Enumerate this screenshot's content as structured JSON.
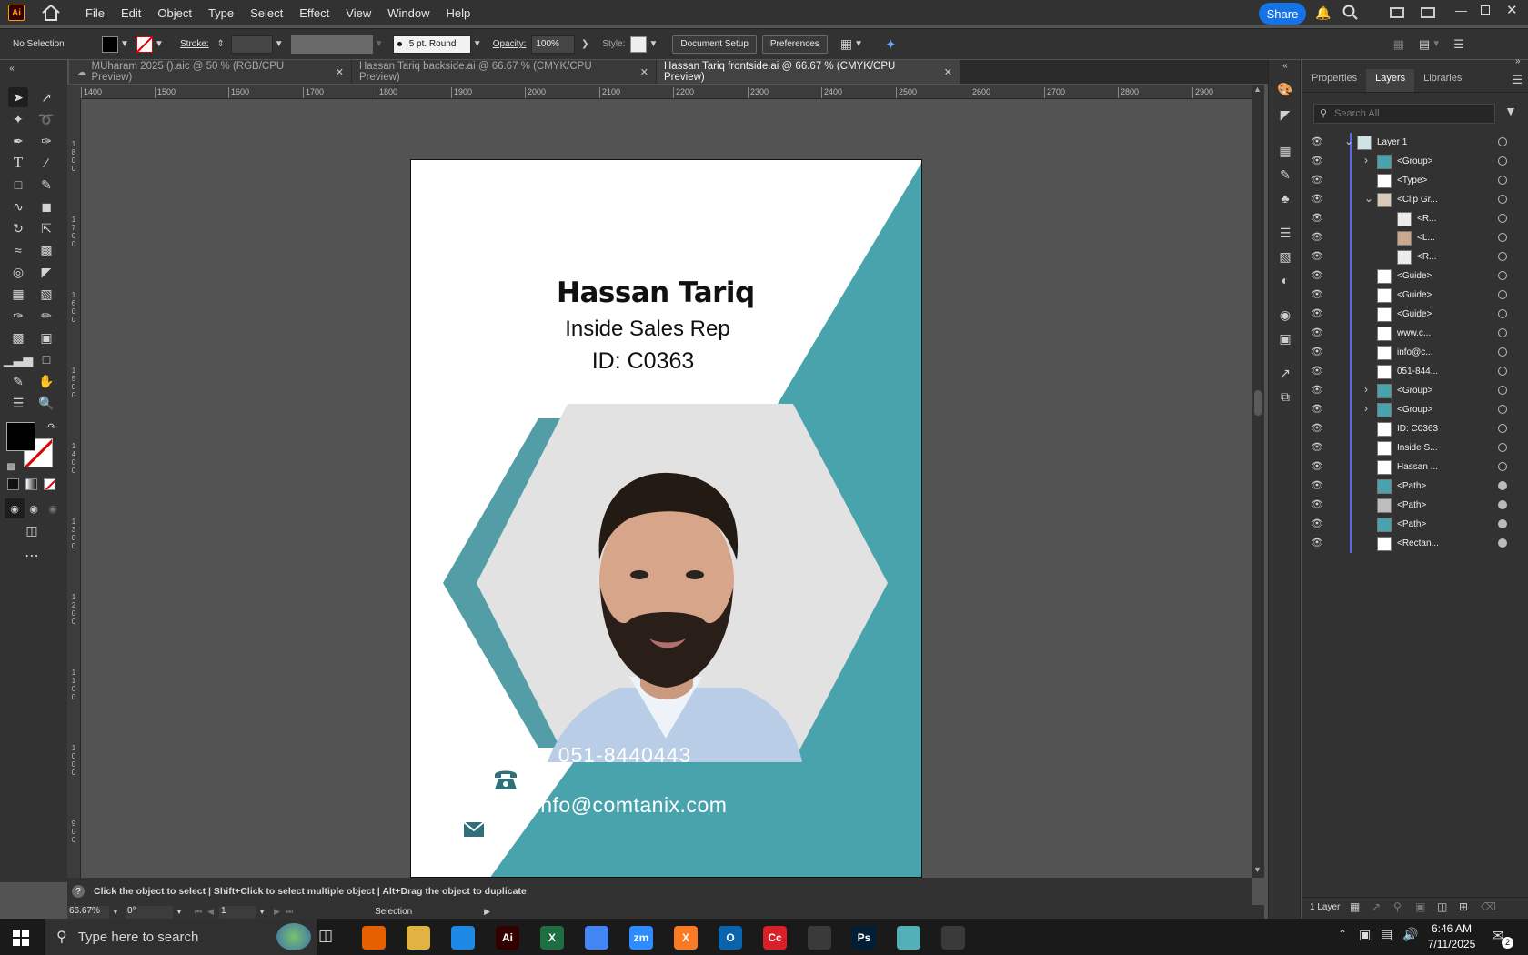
{
  "app": {
    "logo_text": "Ai"
  },
  "menu": [
    "File",
    "Edit",
    "Object",
    "Type",
    "Select",
    "Effect",
    "View",
    "Window",
    "Help"
  ],
  "share_label": "Share",
  "control": {
    "selection": "No Selection",
    "stroke_label": "Stroke:",
    "brush": "5 pt. Round",
    "opacity_label": "Opacity:",
    "opacity_value": "100%",
    "style_label": "Style:",
    "document_setup": "Document Setup",
    "preferences": "Preferences"
  },
  "tabs": [
    {
      "label": "MUharam 2025 ().aic @ 50 % (RGB/CPU Preview)",
      "active": false
    },
    {
      "label": "Hassan Tariq backside.ai @ 66.67 % (CMYK/CPU Preview)",
      "active": false
    },
    {
      "label": "Hassan Tariq frontside.ai @ 66.67 % (CMYK/CPU Preview)",
      "active": true
    }
  ],
  "ruler_h": [
    "1400",
    "1500",
    "1600",
    "1700",
    "1800",
    "1900",
    "2000",
    "2100",
    "2200",
    "2300",
    "2400",
    "2500",
    "2600",
    "2700",
    "2800",
    "2900"
  ],
  "ruler_v": [
    "1800",
    "1700",
    "1600",
    "1500",
    "1400",
    "1300",
    "1200",
    "1100",
    "1000",
    "900"
  ],
  "card": {
    "name": "Hassan Tariq",
    "title": "Inside Sales Rep",
    "id": "ID:  C0363",
    "phone": "051-8440443",
    "email": "info@comtanix.com",
    "accent": "#48a3ac",
    "hex_fill": "#e2e2e2"
  },
  "status": {
    "help": "?",
    "text": "Click the object to select  |  Shift+Click to select multiple object  |  Alt+Drag the object to duplicate",
    "zoom": "66.67%",
    "rotation": "0°",
    "artboard": "1",
    "tool": "Selection"
  },
  "panel": {
    "tabs": [
      "Properties",
      "Layers",
      "Libraries"
    ],
    "search_placeholder": "Search All",
    "layers": [
      {
        "label": "Layer 1",
        "indent": 0,
        "expand": "v",
        "circle": false,
        "thumb": "#cfe3e6"
      },
      {
        "label": "<Group>",
        "indent": 1,
        "expand": ">",
        "circle": false,
        "thumb": "#48a3ac"
      },
      {
        "label": "<Type>",
        "indent": 1,
        "expand": "",
        "circle": false,
        "thumb": "#ffffff"
      },
      {
        "label": "<Clip Gr...",
        "indent": 1,
        "expand": "v",
        "circle": false,
        "thumb": "#d9c9b8"
      },
      {
        "label": "<R...",
        "indent": 2,
        "expand": "",
        "circle": false,
        "thumb": "#ececec"
      },
      {
        "label": "<L...",
        "indent": 2,
        "expand": "",
        "circle": false,
        "thumb": "#caa88c"
      },
      {
        "label": "<R...",
        "indent": 2,
        "expand": "",
        "circle": false,
        "thumb": "#ececec"
      },
      {
        "label": "<Guide>",
        "indent": 1,
        "expand": "",
        "circle": false,
        "thumb": "#ffffff"
      },
      {
        "label": "<Guide>",
        "indent": 1,
        "expand": "",
        "circle": false,
        "thumb": "#ffffff"
      },
      {
        "label": "<Guide>",
        "indent": 1,
        "expand": "",
        "circle": false,
        "thumb": "#ffffff"
      },
      {
        "label": "www.c...",
        "indent": 1,
        "expand": "",
        "circle": false,
        "thumb": "#ffffff"
      },
      {
        "label": "info@c...",
        "indent": 1,
        "expand": "",
        "circle": false,
        "thumb": "#ffffff"
      },
      {
        "label": "051-844...",
        "indent": 1,
        "expand": "",
        "circle": false,
        "thumb": "#ffffff"
      },
      {
        "label": "<Group>",
        "indent": 1,
        "expand": ">",
        "circle": false,
        "thumb": "#48a3ac"
      },
      {
        "label": "<Group>",
        "indent": 1,
        "expand": ">",
        "circle": false,
        "thumb": "#48a3ac"
      },
      {
        "label": "ID:  C0363",
        "indent": 1,
        "expand": "",
        "circle": false,
        "thumb": "#ffffff"
      },
      {
        "label": "Inside S...",
        "indent": 1,
        "expand": "",
        "circle": false,
        "thumb": "#ffffff"
      },
      {
        "label": "Hassan ...",
        "indent": 1,
        "expand": "",
        "circle": false,
        "thumb": "#ffffff"
      },
      {
        "label": "<Path>",
        "indent": 1,
        "expand": "",
        "circle": true,
        "thumb": "#48a3ac"
      },
      {
        "label": "<Path>",
        "indent": 1,
        "expand": "",
        "circle": true,
        "thumb": "#bdbdbd"
      },
      {
        "label": "<Path>",
        "indent": 1,
        "expand": "",
        "circle": true,
        "thumb": "#48a3ac"
      },
      {
        "label": "<Rectan...",
        "indent": 1,
        "expand": "",
        "circle": true,
        "thumb": "#ffffff"
      }
    ],
    "footer": "1 Layer"
  },
  "taskbar": {
    "search_placeholder": "Type here to search",
    "time": "6:46 AM",
    "date": "7/11/2025",
    "notif_count": "2",
    "apps": [
      {
        "name": "firefox",
        "label": "",
        "color": "#e66000"
      },
      {
        "name": "file-explorer",
        "label": "",
        "color": "#e3b341"
      },
      {
        "name": "vscode",
        "label": "",
        "color": "#1e88e5"
      },
      {
        "name": "illustrator",
        "label": "Ai",
        "color": "#330000"
      },
      {
        "name": "excel",
        "label": "X",
        "color": "#1d6f42"
      },
      {
        "name": "chrome",
        "label": "",
        "color": "#4285f4"
      },
      {
        "name": "zoom",
        "label": "zm",
        "color": "#2d8cff"
      },
      {
        "name": "xampp",
        "label": "X",
        "color": "#fb7a24"
      },
      {
        "name": "outlook",
        "label": "O",
        "color": "#0a64ad"
      },
      {
        "name": "creative-cloud",
        "label": "Cc",
        "color": "#da1f26"
      },
      {
        "name": "pen-tool",
        "label": "",
        "color": "#3a3a3a"
      },
      {
        "name": "photoshop",
        "label": "Ps",
        "color": "#001e36"
      },
      {
        "name": "app-diamond",
        "label": "",
        "color": "#52b0b8"
      },
      {
        "name": "snipping-tool",
        "label": "",
        "color": "#3a3a3a"
      }
    ]
  }
}
